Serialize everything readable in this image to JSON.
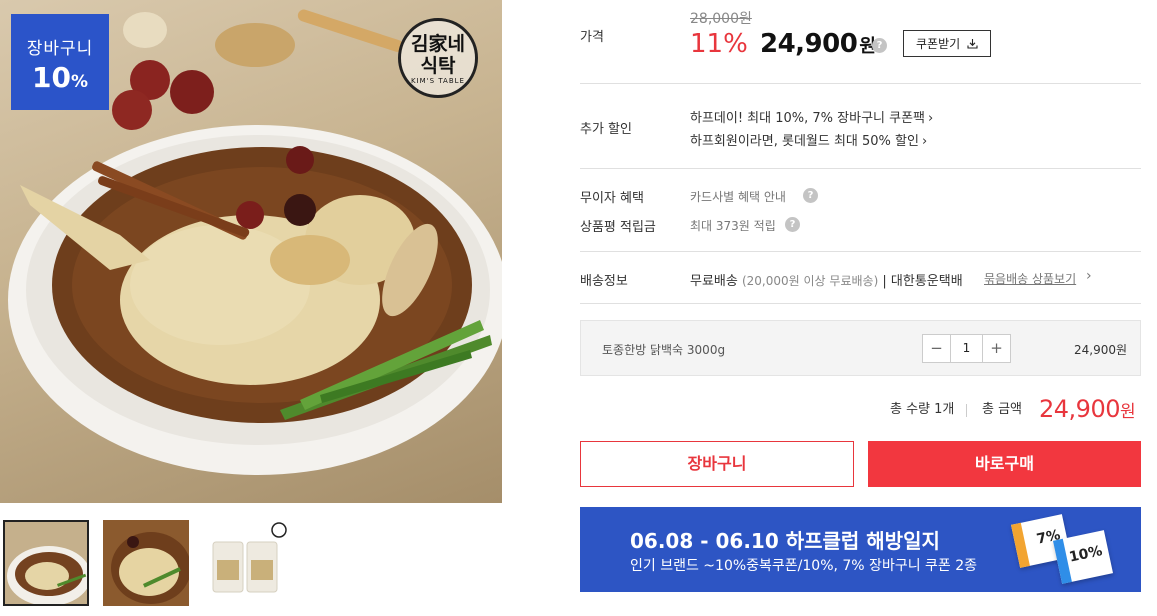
{
  "badge": {
    "line1": "장바구니",
    "line2": "10",
    "pct": "%"
  },
  "brand_logo": {
    "line1": "김家네",
    "line2": "식탁",
    "tag": "KIM'S TABLE"
  },
  "price": {
    "label": "가격",
    "original": "28,000원",
    "discount_rate": "11%",
    "sale_price": "24,900",
    "won": "원",
    "coupon_button": "쿠폰받기"
  },
  "extra_discount": {
    "label": "추가 할인",
    "lines": [
      "하프데이! 최대 10%, 7% 장바구니 쿠폰팩",
      "하프회원이라면, 롯데월드 최대 50% 할인"
    ]
  },
  "benefits": {
    "interest_free_label": "무이자 혜택",
    "interest_free_value": "카드사별 혜택 안내",
    "review_points_label": "상품평 적립금",
    "review_points_value": "최대 373원 적립"
  },
  "shipping": {
    "label": "배송정보",
    "free": "무료배송",
    "condition": "(20,000원 이상 무료배송)",
    "carrier": "| 대한통운택배",
    "bundle_link": "묶음배송 상품보기"
  },
  "option": {
    "name": "토종한방 닭백숙 3000g",
    "minus": "−",
    "quantity": "1",
    "plus": "+",
    "price": "24,900원"
  },
  "total": {
    "qty_text": "총 수량 1개",
    "amount_label": "총 금액",
    "amount": "24,900",
    "won": "원"
  },
  "actions": {
    "cart": "장바구니",
    "buy": "바로구매"
  },
  "banner": {
    "title": "06.08 - 06.10 하프클럽 해방일지",
    "subtitle": "인기 브랜드 ~10%중복쿠폰/10%, 7% 장바구니 쿠폰 2종",
    "coupon1": "7%",
    "coupon2": "10%"
  },
  "icons": [
    "question-icon",
    "download-icon",
    "chevron-right-icon",
    "spoon-icon"
  ],
  "colors": {
    "accent_red": "#e8363d",
    "badge_blue": "#2b54c9",
    "banner_blue": "#2d55c4"
  }
}
